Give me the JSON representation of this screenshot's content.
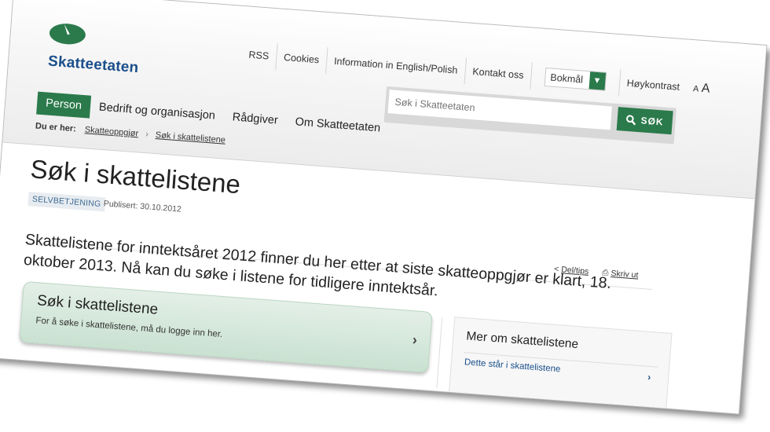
{
  "brand": {
    "name": "Skatteetaten",
    "logo_icon": "skatteetaten-logo-icon",
    "colors": {
      "green": "#2b7a4b",
      "blue": "#1a4f8b"
    }
  },
  "utility_nav": {
    "rss": "RSS",
    "cookies": "Cookies",
    "info_english": "Information in English/Polish",
    "contact": "Kontakt oss",
    "language": "Bokmål",
    "high_contrast": "Høykontrast",
    "font_small": "A",
    "font_large": "A"
  },
  "search": {
    "placeholder": "Søk i Skatteetaten",
    "button": "SØK"
  },
  "main_nav": [
    "Person",
    "Bedrift og organisasjon",
    "Rådgiver",
    "Om Skatteetaten"
  ],
  "breadcrumb": {
    "label": "Du er her:",
    "items": [
      "Skatteoppgjør",
      "Søk i skattelistene"
    ]
  },
  "page": {
    "title": "Søk i skattelistene",
    "badge": "SELVBETJENING",
    "published": "Publisert: 30.10.2012",
    "share": "Del/tips",
    "print": "Skriv ut",
    "intro": "Skattelistene for inntektsåret 2012 finner du her etter at siste skatteoppgjør er klart, 18. oktober 2013. Nå kan du søke i listene for tidligere inntektsår."
  },
  "main_box": {
    "title": "Søk i skattelistene",
    "text": "For å søke i skattelistene, må du logge inn her."
  },
  "side_box": {
    "title": "Mer om skattelistene",
    "link": "Dette står i skattelistene"
  }
}
